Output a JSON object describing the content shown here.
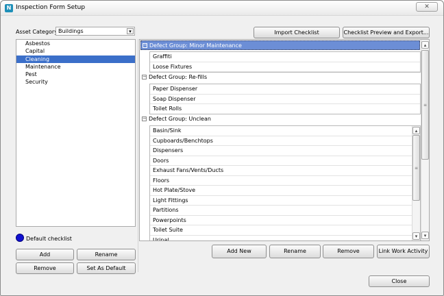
{
  "window": {
    "title": "Inspection Form Setup",
    "close_glyph": "✕"
  },
  "left": {
    "asset_category_label": "Asset Category",
    "asset_category_value": "Buildings",
    "categories": [
      "Asbestos",
      "Capital",
      "Cleaning",
      "Maintenance",
      "Pest",
      "Security"
    ],
    "selected_category": "Cleaning",
    "default_legend": "Default checklist",
    "buttons": {
      "add": "Add",
      "rename": "Rename",
      "remove": "Remove",
      "set_default": "Set As Default"
    }
  },
  "right": {
    "import_label": "Import Checklist",
    "preview_label": "Checklist Preview and Export...",
    "groups": [
      {
        "title": "Defect Group: Minor Maintenance",
        "selected": true,
        "items": [
          "Graffiti",
          "Loose Fixtures"
        ]
      },
      {
        "title": "Defect Group: Re-fills",
        "selected": false,
        "items": [
          "Paper Dispenser",
          "Soap Dispenser",
          "Toilet Rolls"
        ]
      },
      {
        "title": "Defect Group: Unclean",
        "selected": false,
        "items": [
          "Basin/Sink",
          "Cupboards/Benchtops",
          "Dispensers",
          "Doors",
          "Exhaust Fans/Vents/Ducts",
          "Floors",
          "Hot Plate/Stove",
          "Light Fittings",
          "Partitions",
          "Powerpoints",
          "Toilet Suite",
          "Urinal"
        ]
      }
    ],
    "buttons": {
      "add_new": "Add New",
      "rename": "Rename",
      "remove": "Remove",
      "link": "Link Work Activity"
    }
  },
  "footer": {
    "close": "Close"
  },
  "icons": {
    "default_dot_color": "#1010d0",
    "selection_color": "#3b6fc9"
  }
}
